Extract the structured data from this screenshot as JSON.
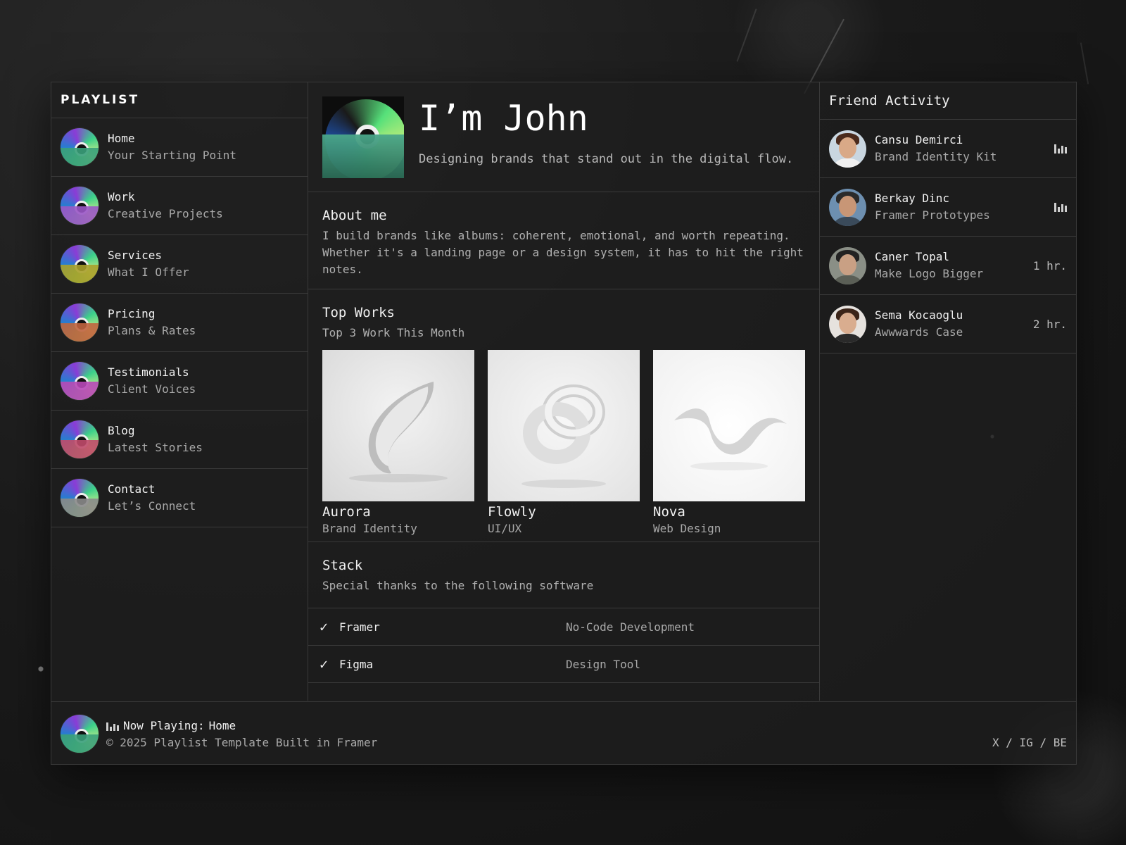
{
  "sidebar": {
    "title": "PLAYLIST",
    "items": [
      {
        "label": "Home",
        "sub": "Your Starting Point",
        "sleeve": "#3aa07a"
      },
      {
        "label": "Work",
        "sub": "Creative Projects",
        "sleeve": "#9a56c6"
      },
      {
        "label": "Services",
        "sub": "What I Offer",
        "sleeve": "#a8a02a"
      },
      {
        "label": "Pricing",
        "sub": "Plans & Rates",
        "sleeve": "#c0643e"
      },
      {
        "label": "Testimonials",
        "sub": "Client Voices",
        "sleeve": "#b848b8"
      },
      {
        "label": "Blog",
        "sub": "Latest Stories",
        "sleeve": "#c04a6a"
      },
      {
        "label": "Contact",
        "sub": "Let’s Connect",
        "sleeve": "#8a8a8a"
      }
    ]
  },
  "hero": {
    "title": "I’m John",
    "subtitle": "Designing brands that stand out in the digital flow."
  },
  "about": {
    "title": "About me",
    "text": "I build brands like albums: coherent, emotional, and worth repeating. Whether it's a landing page or a design system, it has to hit the right notes."
  },
  "works": {
    "title": "Top Works",
    "subtitle": "Top 3 Work This Month",
    "items": [
      {
        "name": "Aurora",
        "sub": "Brand Identity"
      },
      {
        "name": "Flowly",
        "sub": "UI/UX"
      },
      {
        "name": "Nova",
        "sub": "Web Design"
      }
    ]
  },
  "stack": {
    "title": "Stack",
    "subtitle": "Special thanks to the following software",
    "items": [
      {
        "name": "Framer",
        "desc": "No-Code Development"
      },
      {
        "name": "Figma",
        "desc": "Design Tool"
      }
    ]
  },
  "friends": {
    "title": "Friend Activity",
    "items": [
      {
        "name": "Cansu Demirci",
        "track": "Brand Identity Kit",
        "status": "",
        "playing": true
      },
      {
        "name": "Berkay Dinc",
        "track": "Framer Prototypes",
        "status": "",
        "playing": true
      },
      {
        "name": "Caner Topal",
        "track": "Make Logo Bigger",
        "status": "1 hr.",
        "playing": false
      },
      {
        "name": "Sema Kocaoglu",
        "track": "Awwwards Case",
        "status": "2 hr.",
        "playing": false
      }
    ]
  },
  "footer": {
    "now_playing_prefix": "Now Playing:",
    "now_playing_track": "Home",
    "copyright": "© 2025 Playlist Template Built in Framer",
    "social": [
      "X",
      "IG",
      "BE"
    ],
    "separator": "/"
  },
  "icons": {
    "check": "check-icon",
    "equalizer": "equalizer-icon",
    "disc": "disc-icon"
  },
  "colors": {
    "background": "#1b1b1b",
    "panel": "#1e1e1e",
    "divider": "#3a3a3a",
    "text": "#f0f0f0",
    "muted": "#a9a9a9"
  }
}
